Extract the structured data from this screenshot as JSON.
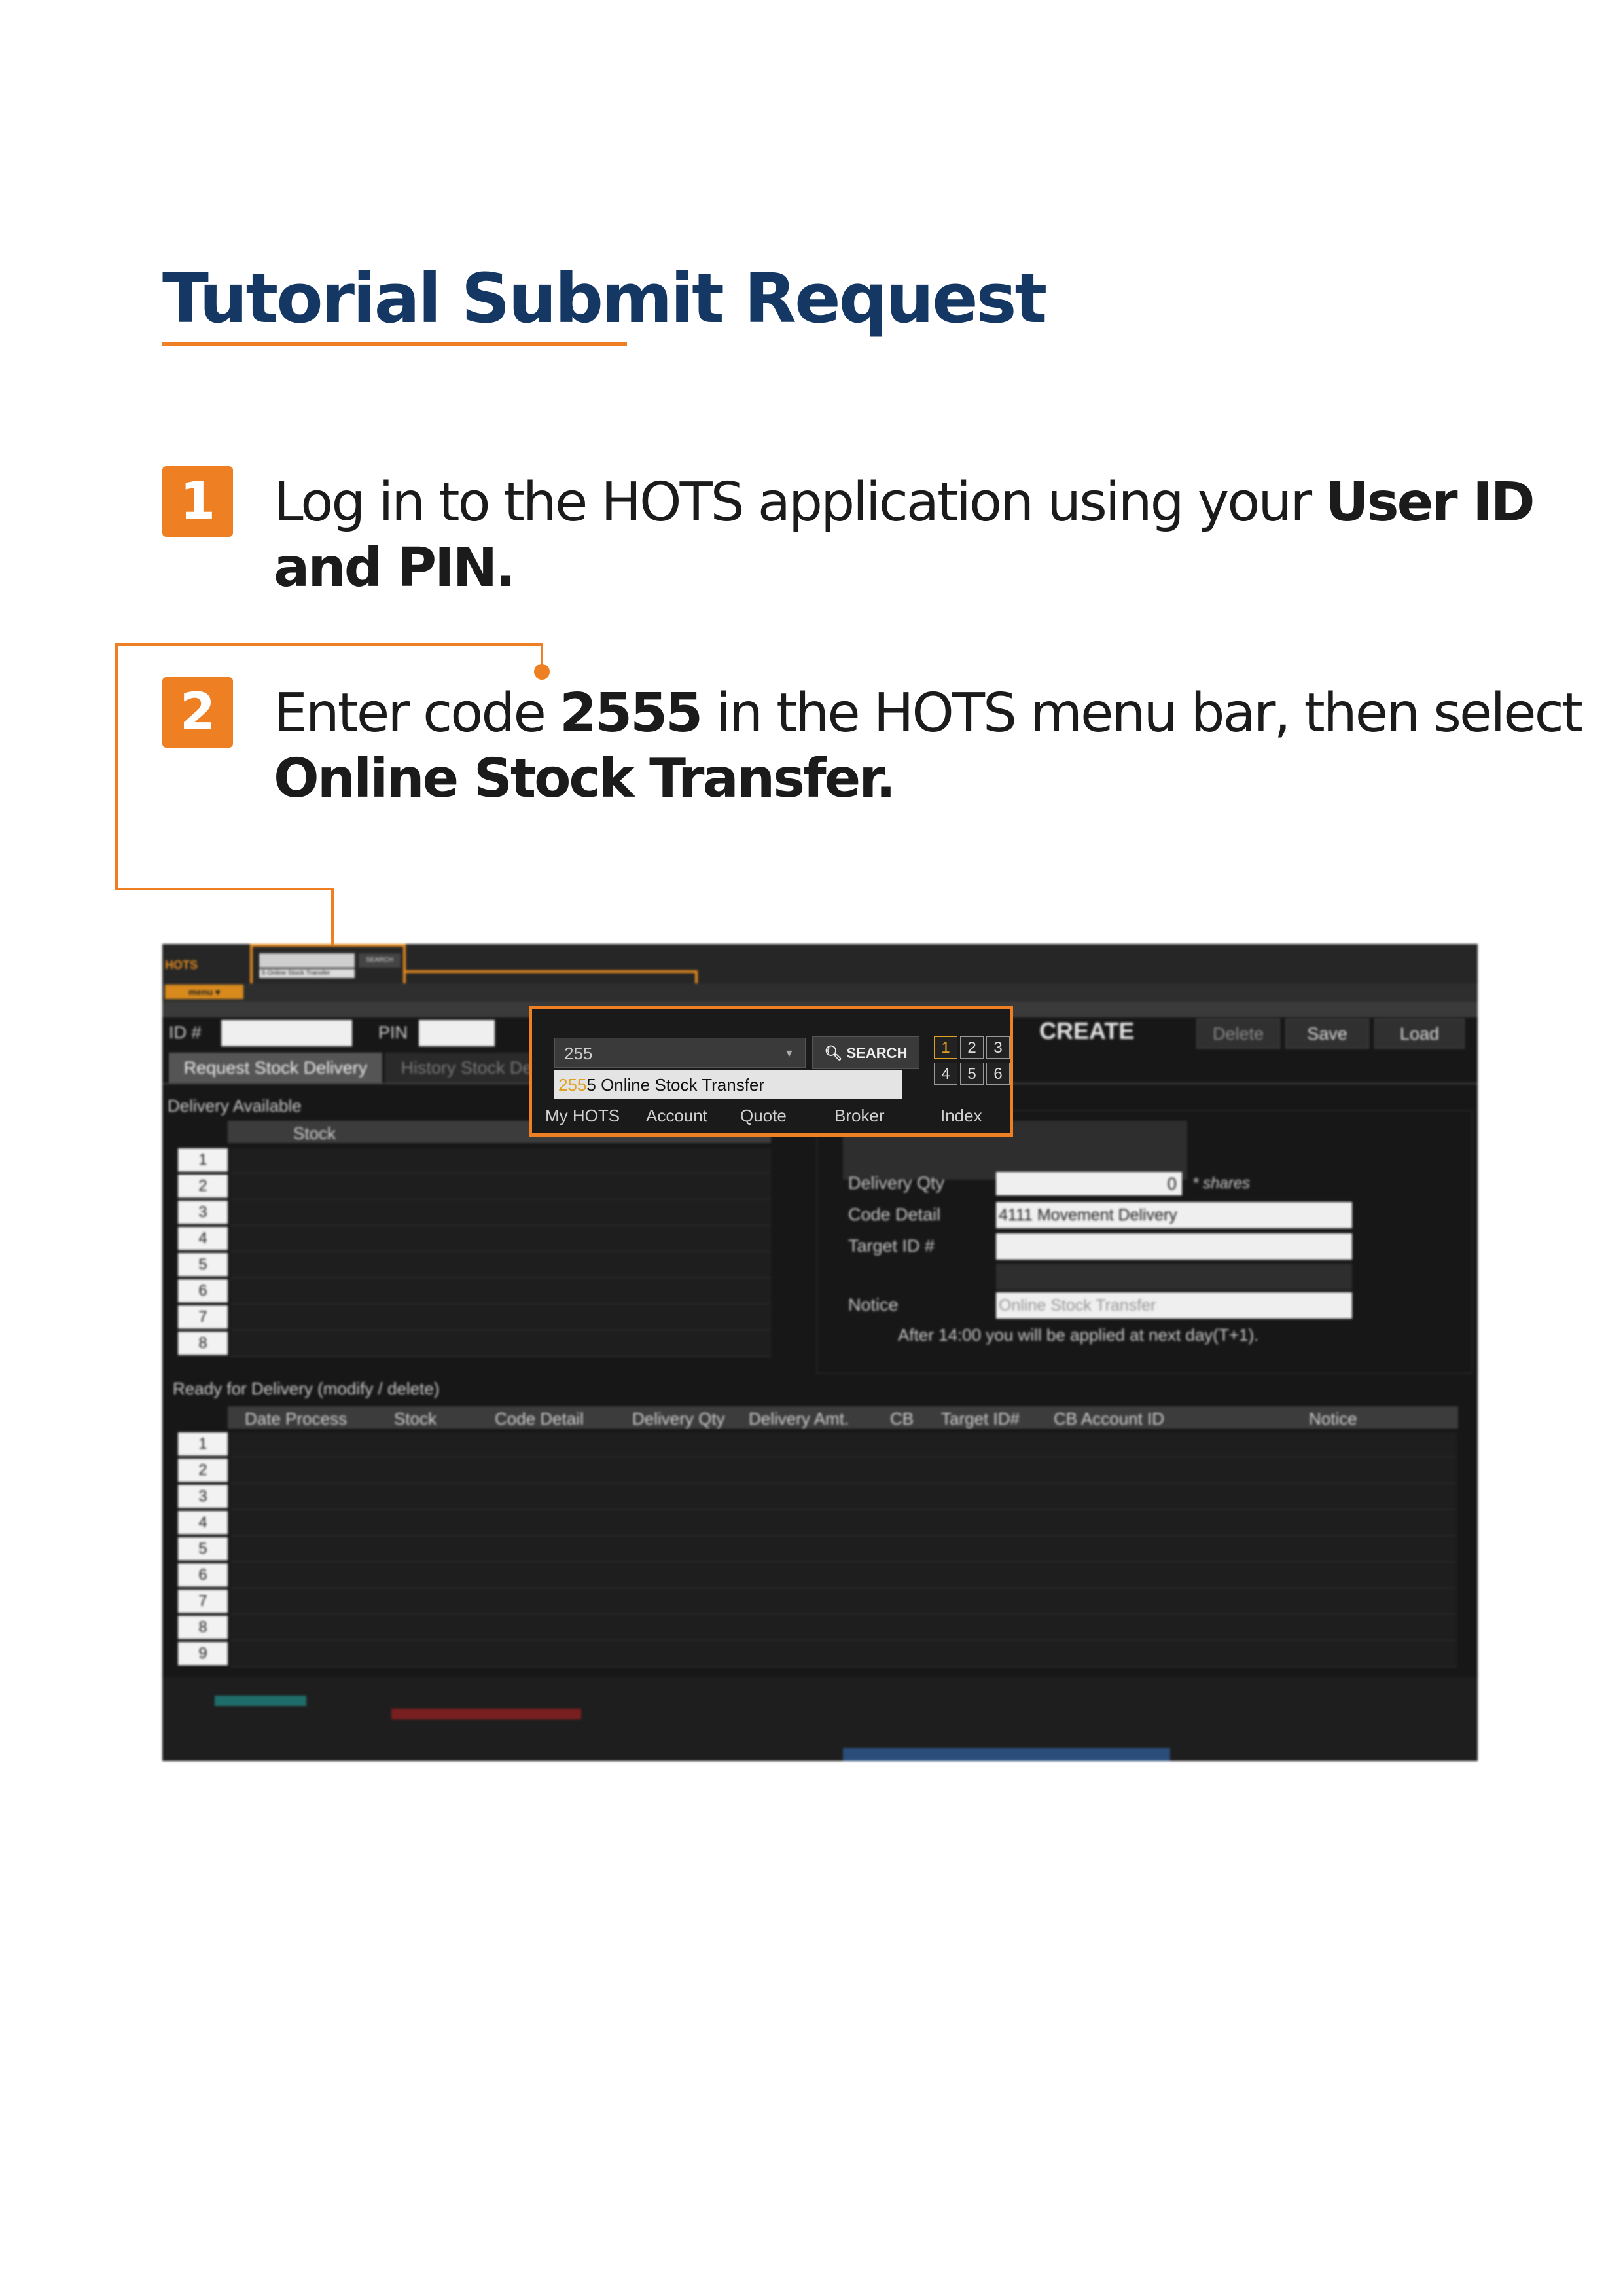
{
  "title": "Tutorial Submit Request",
  "steps": [
    {
      "number": "1",
      "line1_plain": "Log in to the HOTS application using your ",
      "line1_bold": "User ID",
      "line2_bold": "and PIN."
    },
    {
      "number": "2",
      "line1_plain": "Enter code ",
      "line1_bold": "2555",
      "line1_rest": " in the HOTS menu bar, then select",
      "line2_bold": "Online Stock Transfer."
    }
  ],
  "accent_color": "#ee7f22",
  "title_color": "#143763",
  "zoom": {
    "input_value": "255",
    "search_label": "SEARCH",
    "dropdown_highlight": "255",
    "dropdown_rest": "5  Online Stock Transfer",
    "nav": [
      "My HOTS",
      "Account",
      "Quote",
      "Broker",
      "Index"
    ],
    "numbers": [
      "1",
      "2",
      "3",
      "4",
      "5",
      "6"
    ]
  },
  "app": {
    "menu_label": "menu ▾",
    "logo": "HOTS",
    "id_label": "ID #",
    "pin_label": "PIN",
    "create_label": "CREATE",
    "delete_label": "Delete",
    "save_label": "Save",
    "load_label": "Load",
    "tab_active": "Request Stock Delivery",
    "tab_inactive": "History Stock De",
    "delivery_available": "Delivery Available",
    "stock_col": "Stock",
    "available_rows": [
      "1",
      "2",
      "3",
      "4",
      "5",
      "6",
      "7",
      "8"
    ],
    "delivery_qty_label": "Delivery Qty",
    "delivery_qty_value": "0",
    "shares_note": "* shares",
    "code_detail_label": "Code Detail",
    "code_detail_value": "4111 Movement Delivery",
    "target_id_label": "Target ID #",
    "notice_label": "Notice",
    "notice_placeholder": "Online Stock Transfer",
    "after_note": "After 14:00 you will be applied at next day(T+1).",
    "ready_title": "Ready for Delivery (modify / delete)",
    "ready_columns": [
      "Date Process",
      "Stock",
      "Code Detail",
      "Delivery Qty",
      "Delivery Amt.",
      "CB",
      "Target ID#",
      "CB Account ID",
      "Notice"
    ],
    "ready_rows": [
      "1",
      "2",
      "3",
      "4",
      "5",
      "6",
      "7",
      "8",
      "9"
    ]
  }
}
